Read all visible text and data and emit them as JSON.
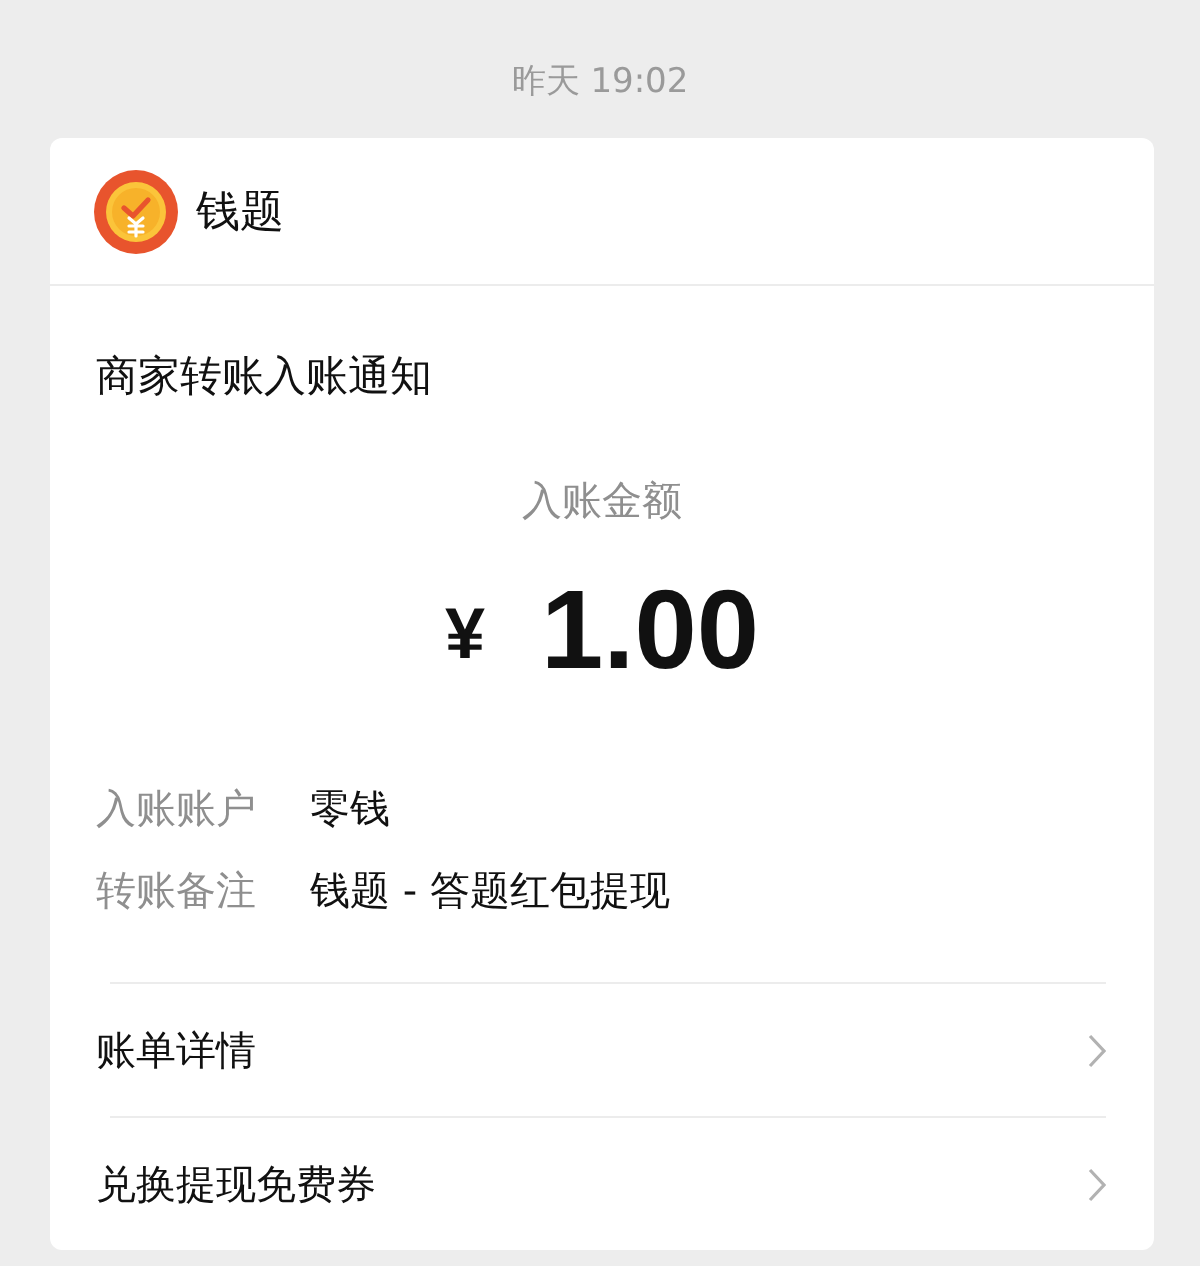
{
  "timestamp": "昨天 19:02",
  "card": {
    "app_name": "钱题",
    "title": "商家转账入账通知",
    "amount_label": "入账金额",
    "currency": "¥",
    "amount": "1.00",
    "details": [
      {
        "label": "入账账户",
        "value": "零钱"
      },
      {
        "label": "转账备注",
        "value": "钱题 - 答题红包提现"
      }
    ],
    "links": [
      {
        "label": "账单详情"
      },
      {
        "label": "兑换提现免费券"
      }
    ]
  }
}
